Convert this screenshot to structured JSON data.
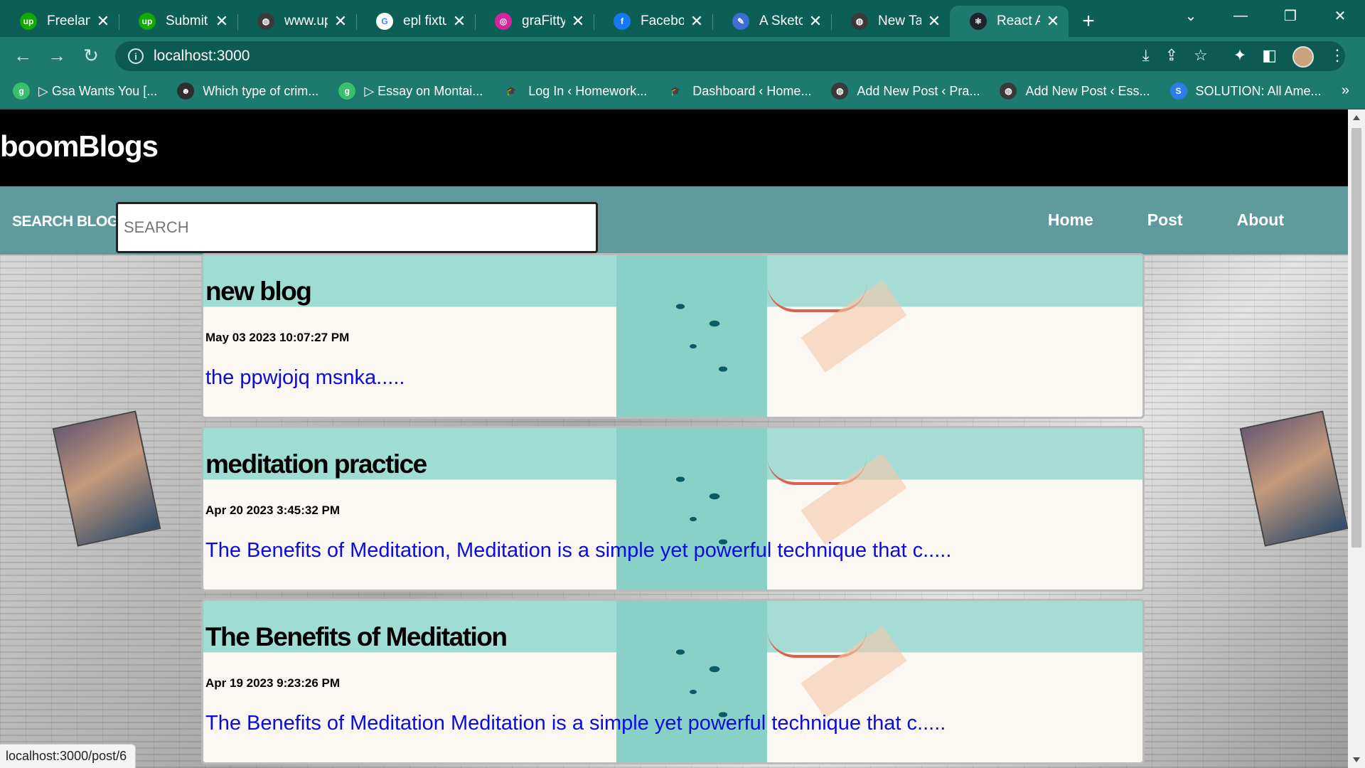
{
  "browser": {
    "tabs": [
      {
        "title": "Freelance",
        "icon": "upwork-icon",
        "color": "#14a800",
        "glyph": "up"
      },
      {
        "title": "Submit a",
        "icon": "upwork-icon",
        "color": "#14a800",
        "glyph": "up"
      },
      {
        "title": "www.upv",
        "icon": "globe-icon",
        "color": "#3a3a3a",
        "glyph": "◍"
      },
      {
        "title": "epl fixtur",
        "icon": "google-icon",
        "color": "#ffffff",
        "glyph": "G"
      },
      {
        "title": "graFitty (",
        "icon": "instagram-icon",
        "color": "#d6249f",
        "glyph": "◎"
      },
      {
        "title": "Faceboo",
        "icon": "facebook-icon",
        "color": "#1877f2",
        "glyph": "f"
      },
      {
        "title": "A Sketch",
        "icon": "sketch-icon",
        "color": "#3b6fd6",
        "glyph": "✎"
      },
      {
        "title": "New Tab",
        "icon": "globe-icon",
        "color": "#3a3a3a",
        "glyph": "◍"
      },
      {
        "title": "React Ap",
        "icon": "react-icon",
        "color": "#20232a",
        "glyph": "⚛",
        "active": true
      }
    ],
    "tab_close": "✕",
    "new_tab": "+",
    "address": "localhost:3000",
    "bookmarks": [
      {
        "label": "▷ Gsa Wants You [...",
        "icon": "bookmark-site-icon",
        "color": "#3bbf6b",
        "glyph": "g"
      },
      {
        "label": "Which type of crim...",
        "icon": "bookmark-person-icon",
        "color": "#2e2e2e",
        "glyph": "☻"
      },
      {
        "label": "▷ Essay on Montai...",
        "icon": "bookmark-site-icon",
        "color": "#3bbf6b",
        "glyph": "g"
      },
      {
        "label": "Log In ‹ Homework...",
        "icon": "bookmark-hat-icon",
        "color": "#1d7a6e",
        "glyph": "🎓"
      },
      {
        "label": "Dashboard ‹ Home...",
        "icon": "bookmark-hat-icon",
        "color": "#1d7a6e",
        "glyph": "🎓"
      },
      {
        "label": "Add New Post ‹ Pra...",
        "icon": "globe-icon",
        "color": "#3a3a3a",
        "glyph": "◍"
      },
      {
        "label": "Add New Post ‹ Ess...",
        "icon": "globe-icon",
        "color": "#3a3a3a",
        "glyph": "◍"
      },
      {
        "label": "SOLUTION: All Ame...",
        "icon": "studypool-icon",
        "color": "#2b7de9",
        "glyph": "S"
      }
    ],
    "bookmarks_more": "»",
    "status_url": "localhost:3000/post/6"
  },
  "site": {
    "title": "boomBlogs",
    "search_label": "SEARCH BLOGS",
    "search_placeholder": "SEARCH",
    "nav": [
      {
        "label": "Home"
      },
      {
        "label": "Post"
      },
      {
        "label": "About"
      }
    ]
  },
  "posts": [
    {
      "title": "new blog",
      "date": "May 03 2023 10:07:27 PM",
      "excerpt": "the ppwjojq msnka....."
    },
    {
      "title": "meditation practice",
      "date": "Apr 20 2023 3:45:32 PM",
      "excerpt": "The Benefits of Meditation, Meditation is a simple yet powerful technique that c....."
    },
    {
      "title": "The Benefits of Meditation",
      "date": "Apr 19 2023 9:23:26 PM",
      "excerpt": "The Benefits of Meditation Meditation is a simple yet powerful technique that c....."
    }
  ],
  "colors": {
    "chrome_tabstrip": "#0b5f54",
    "chrome_toolbar": "#1d7a6e",
    "site_header": "#000000",
    "site_nav": "#5f9b9c",
    "excerpt_link": "#0b0bdc"
  }
}
